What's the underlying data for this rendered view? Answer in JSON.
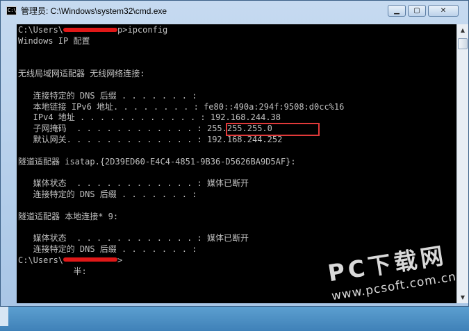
{
  "window": {
    "title": "管理员: C:\\Windows\\system32\\cmd.exe",
    "icon_label": "C:\\",
    "buttons": {
      "minimize": "▁",
      "maximize": "▢",
      "close": "✕"
    }
  },
  "console": {
    "prompt_line_prefix": "C:\\Users\\",
    "prompt_line_suffix": "p>ipconfig",
    "body_text": "\nWindows IP 配置\n\n\n无线局域网适配器 无线网络连接:\n\n   连接特定的 DNS 后缀 . . . . . . . :\n   本地链接 IPv6 地址. . . . . . . . : fe80::490a:294f:9508:d0cc%16\n   IPv4 地址 . . . . . . . . . . . . : 192.168.244.38\n   子网掩码  . . . . . . . . . . . . : 255.255.255.0\n   默认网关. . . . . . . . . . . . . : 192.168.244.252\n\n隧道适配器 isatap.{2D39ED60-E4C4-4851-9B36-D5626BA9D5AF}:\n\n   媒体状态  . . . . . . . . . . . . : 媒体已断开\n   连接特定的 DNS 后缀 . . . . . . . :\n\n隧道适配器 本地连接* 9:\n\n   媒体状态  . . . . . . . . . . . . : 媒体已断开\n   连接特定的 DNS 后缀 . . . . . . . :\n",
    "final_prompt_prefix": "C:\\Users\\",
    "final_prompt_suffix": ">",
    "ime_indicator": "           半:"
  },
  "scrollbar": {
    "up_arrow": "▲",
    "down_arrow": "▼"
  },
  "watermark": {
    "brand": "PC下载网",
    "url": "www.pcsoft.com.cn"
  },
  "colors": {
    "console_bg": "#000000",
    "console_text": "#c0c0c0",
    "highlight": "#e23a3a",
    "redaction": "#e01818"
  }
}
